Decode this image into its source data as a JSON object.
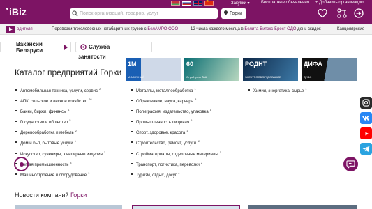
{
  "header": {
    "logo": "iBiz",
    "search_placeholder": "Поиск организаций, товаров, услуг",
    "city": "Горки",
    "top_links": {
      "purchases": "Закупки",
      "free_ads": "Бесплатные объявления",
      "add_company": "+ Добавить организацию"
    }
  },
  "ticker": [
    {
      "text": "одителя"
    },
    {
      "prefix": "Перевозки тяжеловесных негабаритных грузов с ",
      "link": "БелАМРО ООО"
    },
    {
      "prefix": "12 числа каждого месяца в ",
      "link": "Белита-Витэкс-Брест ОДО",
      "suffix": " день скидок"
    },
    {
      "text": "Канцелярские"
    }
  ],
  "tabs": {
    "vacancies": "Вакансии Беларуси",
    "services": "Служба",
    "services_line2": "занятости"
  },
  "catalog": {
    "title": "Каталог предприятий ",
    "city": "Горки",
    "col1": [
      {
        "label": "Автомобильная техника, услуги, сервис",
        "count": "2"
      },
      {
        "label": "АПК, сельское и лесное хозяйство",
        "count": "26"
      },
      {
        "label": "Банки, биржи, финансы",
        "count": "1"
      },
      {
        "label": "Государство и общество",
        "count": "5"
      },
      {
        "label": "Деревообработка и мебель",
        "count": "2"
      },
      {
        "label": "Дом и быт, бытовые услуги",
        "count": "1"
      },
      {
        "label": "Искусство, сувениры, ювелирные изделия",
        "count": "1"
      },
      {
        "label": "Легкая промышленность",
        "count": "4"
      },
      {
        "label": "Машиностроение и оборудование",
        "count": "1"
      }
    ],
    "col2": [
      {
        "label": "Металлы, металлообработка",
        "count": "1"
      },
      {
        "label": "Образование, наука, карьера",
        "count": "8"
      },
      {
        "label": "Полиграфия, издательство, упаковка",
        "count": "1"
      },
      {
        "label": "Промышленность пищевая",
        "count": "5"
      },
      {
        "label": "Спорт, здоровье, красота",
        "count": "1"
      },
      {
        "label": "Строительство, ремонт, услуги",
        "count": "11"
      },
      {
        "label": "Стройматериалы, отделочные материалы",
        "count": "1"
      },
      {
        "label": "Транспорт, логистика, перевозки",
        "count": "2"
      },
      {
        "label": "Туризм, отдых, досуг",
        "count": "4"
      }
    ],
    "col3": [
      {
        "label": "Химия, энергетика, сырье",
        "count": "1"
      }
    ]
  },
  "banners": [
    {
      "title": "1М",
      "subtitle": "МОЛОЧНЫЙ"
    },
    {
      "title": "60",
      "subtitle": "Стройтрест №6"
    },
    {
      "title": "РОДНТ",
      "subtitle": "ЭЛЕКТРООБОРУДОВАНИЕ"
    },
    {
      "title": "ДИФА",
      "subtitle": "ДИФА"
    }
  ],
  "news": {
    "title": "Новости компаний ",
    "city": "Горки"
  },
  "colors": {
    "brand": "#7d1464",
    "ticker_bg": "#f2f2f2"
  }
}
